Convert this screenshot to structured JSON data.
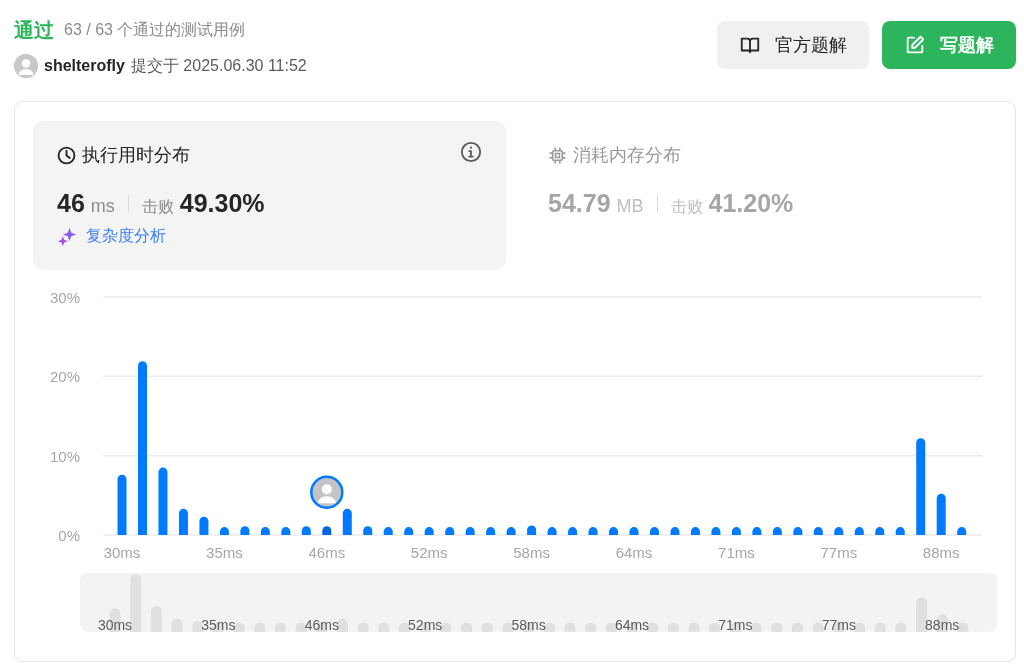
{
  "result": {
    "status": "通过",
    "cases": "63 / 63 个通过的测试用例",
    "user": "shelterofly",
    "submitted": "提交于 2025.06.30 11:52"
  },
  "buttons": [
    {
      "kind": "solution",
      "label": "官方题解"
    },
    {
      "kind": "write",
      "label": "写题解"
    }
  ],
  "stat_tabs": [
    {
      "kind": "runtime",
      "title": "执行用时分布",
      "selected": true,
      "value": "46",
      "unit": "ms",
      "beats_label": "击败",
      "beats": "49.30%",
      "link": "复杂度分析"
    },
    {
      "kind": "memory",
      "title": "消耗内存分布",
      "selected": false,
      "value": "54.79",
      "unit": "MB",
      "beats_label": "击败",
      "beats": "41.20%"
    }
  ],
  "chart_data": {
    "type": "bar",
    "categories": [
      "30ms",
      null,
      null,
      null,
      null,
      "35ms",
      null,
      null,
      null,
      null,
      "46ms",
      null,
      null,
      null,
      null,
      "52ms",
      null,
      null,
      null,
      null,
      "58ms",
      null,
      null,
      null,
      null,
      "64ms",
      null,
      null,
      null,
      null,
      "71ms",
      null,
      null,
      null,
      null,
      "77ms",
      null,
      null,
      null,
      null,
      "88ms",
      null
    ],
    "values": [
      7.6,
      21.9,
      8.5,
      3.3,
      2.3,
      1.0,
      1.1,
      1.0,
      1.0,
      1.1,
      1.1,
      3.3,
      1.1,
      1.0,
      1.0,
      1.0,
      1.0,
      1.0,
      1.0,
      1.0,
      1.2,
      1.0,
      1.0,
      1.0,
      1.0,
      1.0,
      1.0,
      1.0,
      1.0,
      1.0,
      1.0,
      1.0,
      1.0,
      1.0,
      1.0,
      1.0,
      1.0,
      1.0,
      1.0,
      12.2,
      5.2,
      1.0
    ],
    "ylim": [
      0,
      30
    ],
    "yticks": [
      {
        "value": 0,
        "label": "0%"
      },
      {
        "value": 10,
        "label": "10%"
      },
      {
        "value": 20,
        "label": "20%"
      },
      {
        "value": 30,
        "label": "30%"
      }
    ],
    "annotations": [
      {
        "x": "46ms"
      }
    ]
  },
  "navigator": {
    "labels": [
      "30ms",
      "35ms",
      "46ms",
      "52ms",
      "58ms",
      "64ms",
      "71ms",
      "77ms",
      "88ms"
    ]
  }
}
